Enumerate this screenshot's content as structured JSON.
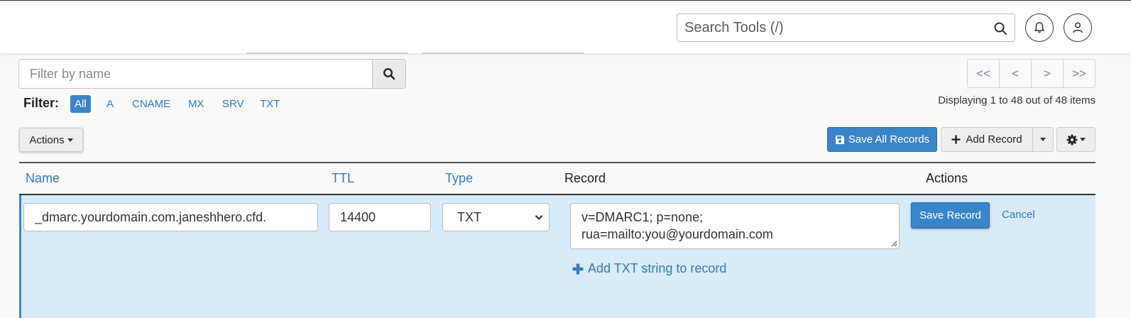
{
  "header": {
    "search_placeholder": "Search Tools (/)",
    "icons": [
      "search-icon",
      "bell-icon",
      "user-icon"
    ]
  },
  "filter": {
    "name_placeholder": "Filter by name",
    "label": "Filter:",
    "types": [
      "All",
      "A",
      "CNAME",
      "MX",
      "SRV",
      "TXT"
    ],
    "active_type": "All"
  },
  "pagination": {
    "first": "<<",
    "prev": "<",
    "next": ">",
    "last": ">>",
    "status": "Displaying 1 to 48 out of 48 items"
  },
  "toolbar": {
    "actions_label": "Actions",
    "save_all_label": "Save All Records",
    "add_record_label": "Add Record"
  },
  "table": {
    "columns": {
      "name": "Name",
      "ttl": "TTL",
      "type": "Type",
      "record": "Record",
      "actions": "Actions"
    },
    "edit_row": {
      "name": "_dmarc.yourdomain.com.janeshhero.cfd.",
      "ttl": "14400",
      "type": "TXT",
      "record": "v=DMARC1; p=none; rua=mailto:you@yourdomain.com",
      "add_txt_label": "Add TXT string to record",
      "save_label": "Save Record",
      "cancel_label": "Cancel"
    }
  },
  "colors": {
    "primary": "#3a85ca",
    "link": "#337ab7",
    "edit_row_bg": "#d8ebf8",
    "header_dark": "#293a4a"
  }
}
